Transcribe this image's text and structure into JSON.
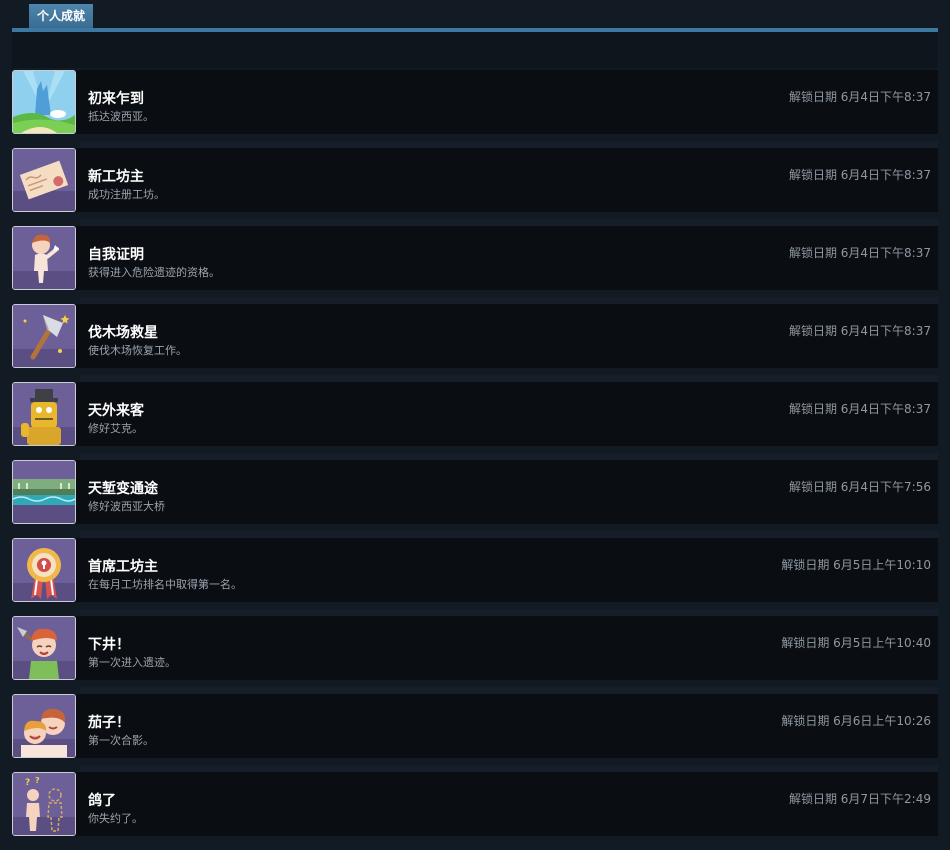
{
  "tab": {
    "label": "个人成就"
  },
  "achievements": [
    {
      "title": "初来乍到",
      "desc": "抵达波西亚。",
      "time": "解锁日期 6月4日下午8:37",
      "icon": "landscape-icon"
    },
    {
      "title": "新工坊主",
      "desc": "成功注册工坊。",
      "time": "解锁日期 6月4日下午8:37",
      "icon": "letter-icon"
    },
    {
      "title": "自我证明",
      "desc": "获得进入危险遗迹的资格。",
      "time": "解锁日期 6月4日下午8:37",
      "icon": "child-icon"
    },
    {
      "title": "伐木场救星",
      "desc": "使伐木场恢复工作。",
      "time": "解锁日期 6月4日下午8:37",
      "icon": "axe-icon"
    },
    {
      "title": "天外来客",
      "desc": "修好艾克。",
      "time": "解锁日期 6月4日下午8:37",
      "icon": "robot-icon"
    },
    {
      "title": "天堑变通途",
      "desc": "修好波西亚大桥",
      "time": "解锁日期 6月4日下午7:56",
      "icon": "bridge-icon"
    },
    {
      "title": "首席工坊主",
      "desc": "在每月工坊排名中取得第一名。",
      "time": "解锁日期 6月5日上午10:10",
      "icon": "medal-icon"
    },
    {
      "title": "下井！",
      "desc": "第一次进入遗迹。",
      "time": "解锁日期 6月5日上午10:40",
      "icon": "miner-icon"
    },
    {
      "title": "茄子！",
      "desc": "第一次合影。",
      "time": "解锁日期 6月6日上午10:26",
      "icon": "selfie-icon"
    },
    {
      "title": "鸽了",
      "desc": "你失约了。",
      "time": "解锁日期 6月7日下午2:49",
      "icon": "missing-person-icon"
    }
  ]
}
